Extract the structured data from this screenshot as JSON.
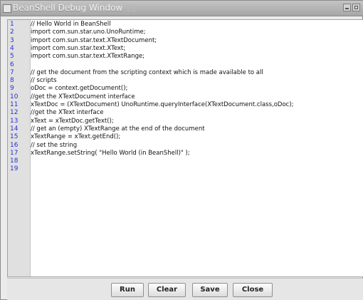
{
  "window": {
    "title": "BeanShell Debug Window",
    "icons": [
      "window-menu-icon",
      "minimize-icon",
      "maximize-icon"
    ]
  },
  "editor": {
    "line_numbers": [
      "1",
      "2",
      "3",
      "4",
      "5",
      "6",
      "7",
      "8",
      "9",
      "10",
      "11",
      "12",
      "13",
      "14",
      "15",
      "16",
      "17",
      "18",
      "19"
    ],
    "lines": [
      "// Hello World in BeanShell",
      "import com.sun.star.uno.UnoRuntime;",
      "import com.sun.star.text.XTextDocument;",
      "import com.sun.star.text.XText;",
      "import com.sun.star.text.XTextRange;",
      "",
      "// get the document from the scripting context which is made available to all",
      "// scripts",
      "oDoc = context.getDocument();",
      "//get the XTextDocument interface",
      "xTextDoc = (XTextDocument) UnoRuntime.queryInterface(XTextDocument.class,oDoc);",
      "//get the XText interface",
      "xText = xTextDoc.getText();",
      "// get an (empty) XTextRange at the end of the document",
      "xTextRange = xText.getEnd();",
      "// set the string",
      "xTextRange.setString( \"Hello World (in BeanShell)\" );",
      "",
      ""
    ]
  },
  "buttons": {
    "run": "Run",
    "clear": "Clear",
    "save": "Save",
    "close": "Close"
  }
}
